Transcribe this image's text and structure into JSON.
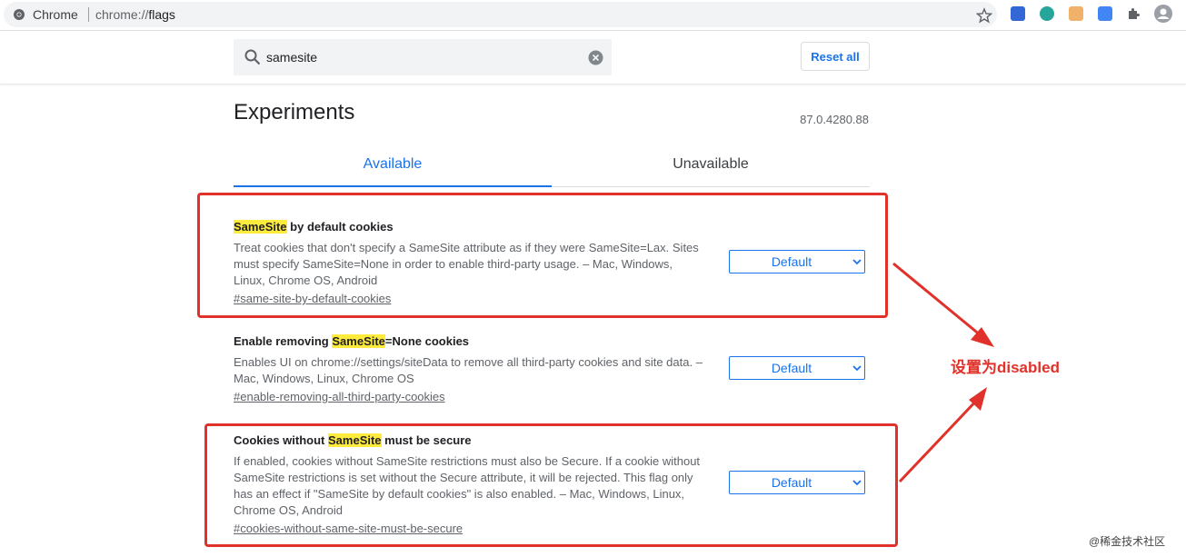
{
  "browser": {
    "site_name": "Chrome",
    "url_scheme": "chrome://",
    "url_path": "flags"
  },
  "search": {
    "value": "samesite",
    "reset_label": "Reset all"
  },
  "page": {
    "title": "Experiments",
    "version": "87.0.4280.88"
  },
  "tabs": [
    {
      "label": "Available"
    },
    {
      "label": "Unavailable"
    }
  ],
  "experiments": [
    {
      "title_pre": "",
      "title_highlight": "SameSite",
      "title_post": " by default cookies",
      "description": "Treat cookies that don't specify a SameSite attribute as if they were SameSite=Lax. Sites must specify SameSite=None in order to enable third-party usage. – Mac, Windows, Linux, Chrome OS, Android",
      "link": "#same-site-by-default-cookies",
      "select_value": "Default"
    },
    {
      "title_pre": "Enable removing ",
      "title_highlight": "SameSite",
      "title_post": "=None cookies",
      "description": "Enables UI on chrome://settings/siteData to remove all third-party cookies and site data. – Mac, Windows, Linux, Chrome OS",
      "link": "#enable-removing-all-third-party-cookies",
      "select_value": "Default"
    },
    {
      "title_pre": "Cookies without ",
      "title_highlight": "SameSite",
      "title_post": " must be secure",
      "description": "If enabled, cookies without SameSite restrictions must also be Secure. If a cookie without SameSite restrictions is set without the Secure attribute, it will be rejected. This flag only has an effect if \"SameSite by default cookies\" is also enabled. – Mac, Windows, Linux, Chrome OS, Android",
      "link": "#cookies-without-same-site-must-be-secure",
      "select_value": "Default"
    }
  ],
  "annotation": {
    "text": "设置为disabled",
    "color": "#e0322a"
  },
  "watermark": "@稀金技术社区",
  "colors": {
    "accent": "#1a73e8",
    "highlight": "#ffeb3b"
  }
}
